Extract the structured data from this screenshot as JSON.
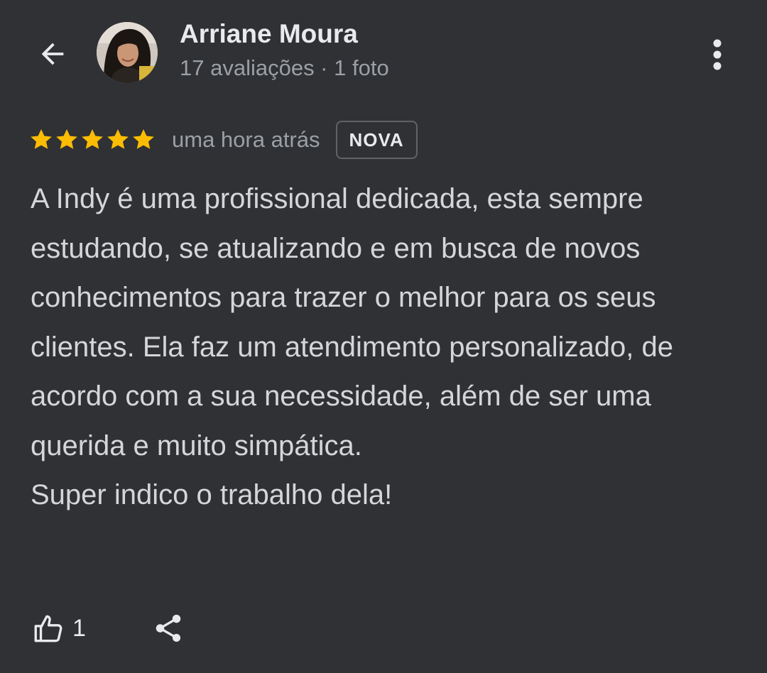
{
  "header": {
    "back_icon": "arrow-left-icon",
    "author_name": "Arriane Moura",
    "author_meta": "17 avaliações · 1 foto",
    "more_icon": "more-vertical-icon"
  },
  "review": {
    "rating": 5,
    "rating_max": 5,
    "star_color": "#fbbc04",
    "time": "uma hora atrás",
    "badge": "NOVA",
    "paragraphs": [
      "A Indy é uma profissional dedicada, esta sempre estudando, se atualizando e em busca de novos conhecimentos para trazer o melhor para os seus clientes. Ela faz um atendimento personalizado, de acordo com a sua necessidade, além de ser uma querida e muito simpática.",
      "Super indico o trabalho dela!"
    ]
  },
  "actions": {
    "like_icon": "thumbs-up-icon",
    "like_count": "1",
    "share_icon": "share-icon"
  },
  "colors": {
    "background": "#303134",
    "text_primary": "#e8eaed",
    "text_secondary": "#9aa0a6"
  }
}
